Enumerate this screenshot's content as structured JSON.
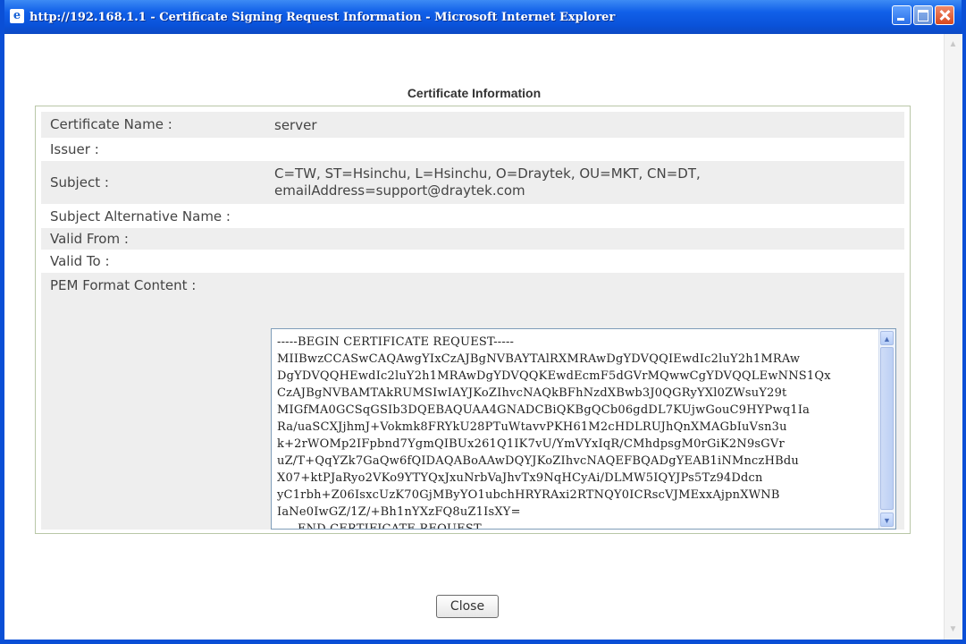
{
  "window": {
    "title": "http://192.168.1.1 - Certificate Signing Request Information - Microsoft Internet Explorer",
    "icon": "ie-icon",
    "controls": [
      "minimize-button",
      "maximize-button",
      "close-window-button"
    ]
  },
  "section_title": "Certificate Information",
  "fields": [
    {
      "label": "Certificate Name :",
      "value": "server"
    },
    {
      "label": "Issuer :",
      "value": ""
    },
    {
      "label": "Subject :",
      "value": "C=TW, ST=Hsinchu, L=Hsinchu, O=Draytek, OU=MKT, CN=DT, emailAddress=support@draytek.com"
    },
    {
      "label": "Subject Alternative Name :",
      "value": ""
    },
    {
      "label": "Valid From :",
      "value": ""
    },
    {
      "label": "Valid To :",
      "value": ""
    },
    {
      "label": "PEM Format Content :",
      "value": ""
    }
  ],
  "pem_lines": [
    "-----BEGIN CERTIFICATE REQUEST-----",
    "MIIBwzCCASwCAQAwgYIxCzAJBgNVBAYTAlRXMRAwDgYDVQQIEwdIc2luY2h1MRAw",
    "DgYDVQQHEwdIc2luY2h1MRAwDgYDVQQKEwdEcmF5dGVrMQwwCgYDVQQLEwNNS1Qx",
    "CzAJBgNVBAMTAkRUMSIwIAYJKoZIhvcNAQkBFhNzdXBwb3J0QGRyYXl0ZWsuY29t",
    "MIGfMA0GCSqGSIb3DQEBAQUAA4GNADCBiQKBgQCb06gdDL7KUjwGouC9HYPwq1Ia",
    "Ra/uaSCXJjhmJ+Vokmk8FRYkU28PTuWtavvPKH61M2cHDLRUJhQnXMAGbIuVsn3u",
    "k+2rWOMp2IFpbnd7YgmQIBUx261Q1IK7vU/YmVYxIqR/CMhdpsgM0rGiK2N9sGVr",
    "uZ/T+QqYZk7GaQw6fQIDAQABoAAwDQYJKoZIhvcNAQEFBQADgYEAB1iNMnczHBdu",
    "X07+ktPJaRyo2VKo9YTYQxJxuNrbVaJhvTx9NqHCyAi/DLMW5IQYJPs5Tz94Ddcn",
    "yC1rbh+Z06IsxcUzK70GjMByYO1ubchHRYRAxi2RTNQY0ICRscVJMExxAjpnXWNB",
    "IaNe0IwGZ/1Z/+Bh1nYXzFQ8uZ1IsXY=",
    "-----END CERTIFICATE REQUEST-----"
  ],
  "close_button": "Close"
}
